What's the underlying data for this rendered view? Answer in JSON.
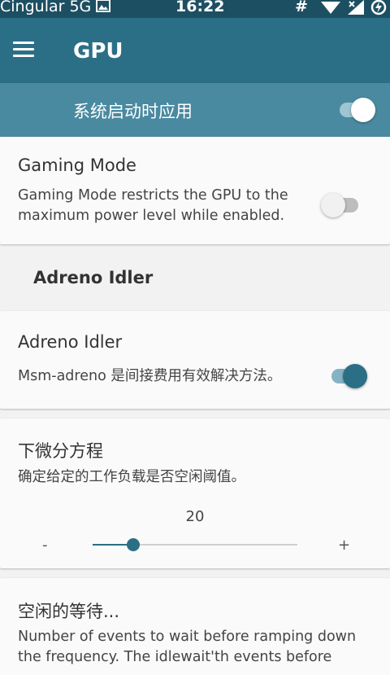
{
  "status_bar": {
    "carrier": "Cingular 5G",
    "time": "16:22",
    "hash": "#"
  },
  "app_bar": {
    "title": "GPU",
    "menu_icon": "hamburger-menu-icon"
  },
  "master_switch": {
    "label": "系统启动时应用",
    "on": true
  },
  "gaming_mode": {
    "title": "Gaming Mode",
    "line1": "Gaming Mode restricts the GPU to the",
    "line2": "maximum power level while enabled.",
    "on": false
  },
  "section_adreno": {
    "header": "Adreno Idler"
  },
  "adreno_idler": {
    "title": "Adreno Idler",
    "description": "Msm-adreno 是间接费用有效解决方法。",
    "on": true
  },
  "differential": {
    "title": "下微分方程",
    "description": "确定给定的工作负载是否空闲阈值。",
    "value": "20",
    "minus": "-",
    "plus": "+",
    "fill_fraction": 0.2
  },
  "idle_wait": {
    "title": "空闲的等待...",
    "line1": "Number of events to wait before ramping down",
    "line2": "the frequency. The idlewait'th events before"
  },
  "colors": {
    "status_bar": "#1d4f63",
    "app_bar": "#2b6f86",
    "master_bar": "#4a8aa0",
    "accent": "#2b6f86",
    "background": "#f2f2f2"
  }
}
